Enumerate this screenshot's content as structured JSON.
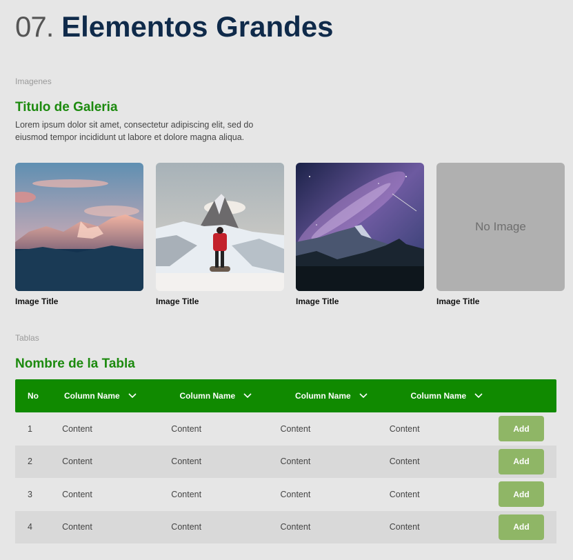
{
  "header": {
    "number": "07.",
    "title": "Elementos Grandes"
  },
  "gallery_section": {
    "label": "Imagenes",
    "title": "Titulo de Galeria",
    "description": "Lorem ipsum dolor sit amet, consectetur adipiscing elit, sed do eiusmod tempor incididunt ut labore et dolore magna aliqua.",
    "cards": [
      {
        "title": "Image Title",
        "image": "mountain-sunset-photo"
      },
      {
        "title": "Image Title",
        "image": "hiker-matterhorn-photo"
      },
      {
        "title": "Image Title",
        "image": "milky-way-mountain-photo"
      },
      {
        "title": "Image Title",
        "image": "placeholder",
        "placeholder_text": "No Image"
      }
    ]
  },
  "table_section": {
    "label": "Tablas",
    "title": "Nombre de la Tabla",
    "header_color": "#108a00",
    "button_color": "#8fb666",
    "columns": [
      "No",
      "Column Name",
      "Column Name",
      "Column Name",
      "Column Name"
    ],
    "rows": [
      {
        "no": "1",
        "cells": [
          "Content",
          "Content",
          "Content",
          "Content"
        ],
        "action": "Add"
      },
      {
        "no": "2",
        "cells": [
          "Content",
          "Content",
          "Content",
          "Content"
        ],
        "action": "Add"
      },
      {
        "no": "3",
        "cells": [
          "Content",
          "Content",
          "Content",
          "Content"
        ],
        "action": "Add"
      },
      {
        "no": "4",
        "cells": [
          "Content",
          "Content",
          "Content",
          "Content"
        ],
        "action": "Add"
      }
    ]
  }
}
